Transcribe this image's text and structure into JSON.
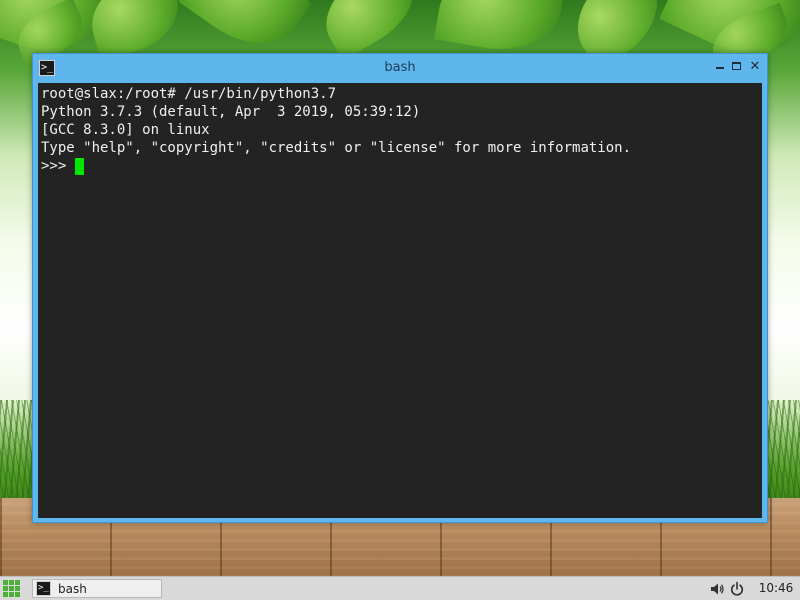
{
  "window": {
    "title": "bash",
    "app_icon": "terminal-icon",
    "controls": {
      "minimize": "minimize-icon",
      "maximize": "maximize-icon",
      "close": "✕"
    }
  },
  "terminal": {
    "lines": [
      "root@slax:/root# /usr/bin/python3.7",
      "Python 3.7.3 (default, Apr  3 2019, 05:39:12)",
      "[GCC 8.3.0] on linux",
      "Type \"help\", \"copyright\", \"credits\" or \"license\" for more information."
    ],
    "prompt": ">>> ",
    "cursor_color": "#00e600",
    "background": "#232323",
    "foreground": "#f0f0f0"
  },
  "taskbar": {
    "start_icon": "apps-grid-icon",
    "tasks": [
      {
        "label": "bash",
        "icon": "terminal-icon"
      }
    ],
    "tray": {
      "volume_icon": "volume-icon",
      "power_icon": "power-icon",
      "clock": "10:46"
    }
  },
  "colors": {
    "window_frame": "#5eb6ec",
    "accent_green": "#4caf3a"
  }
}
